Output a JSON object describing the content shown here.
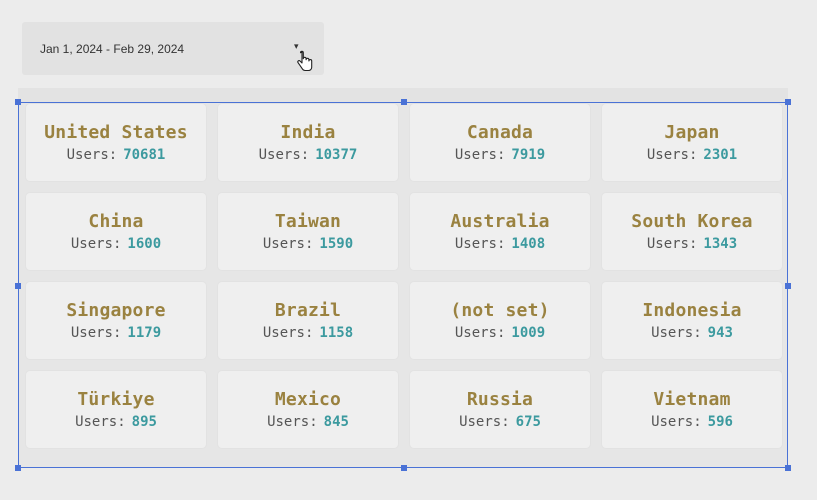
{
  "date_range": {
    "label": "Jan 1, 2024 - Feb 29, 2024"
  },
  "users_prefix": "Users:",
  "colors": {
    "country_text": "#9a8240",
    "value_text": "#3c9a9f",
    "selection": "#4a72d6"
  },
  "countries": [
    {
      "name": "United States",
      "users": "70681"
    },
    {
      "name": "India",
      "users": "10377"
    },
    {
      "name": "Canada",
      "users": "7919"
    },
    {
      "name": "Japan",
      "users": "2301"
    },
    {
      "name": "China",
      "users": "1600"
    },
    {
      "name": "Taiwan",
      "users": "1590"
    },
    {
      "name": "Australia",
      "users": "1408"
    },
    {
      "name": "South Korea",
      "users": "1343"
    },
    {
      "name": "Singapore",
      "users": "1179"
    },
    {
      "name": "Brazil",
      "users": "1158"
    },
    {
      "name": "(not set)",
      "users": "1009"
    },
    {
      "name": "Indonesia",
      "users": "943"
    },
    {
      "name": "Türkiye",
      "users": "895"
    },
    {
      "name": "Mexico",
      "users": "845"
    },
    {
      "name": "Russia",
      "users": "675"
    },
    {
      "name": "Vietnam",
      "users": "596"
    }
  ],
  "icons": {
    "dropdown": "caret-down-icon",
    "cursor": "hand-pointer-icon"
  }
}
